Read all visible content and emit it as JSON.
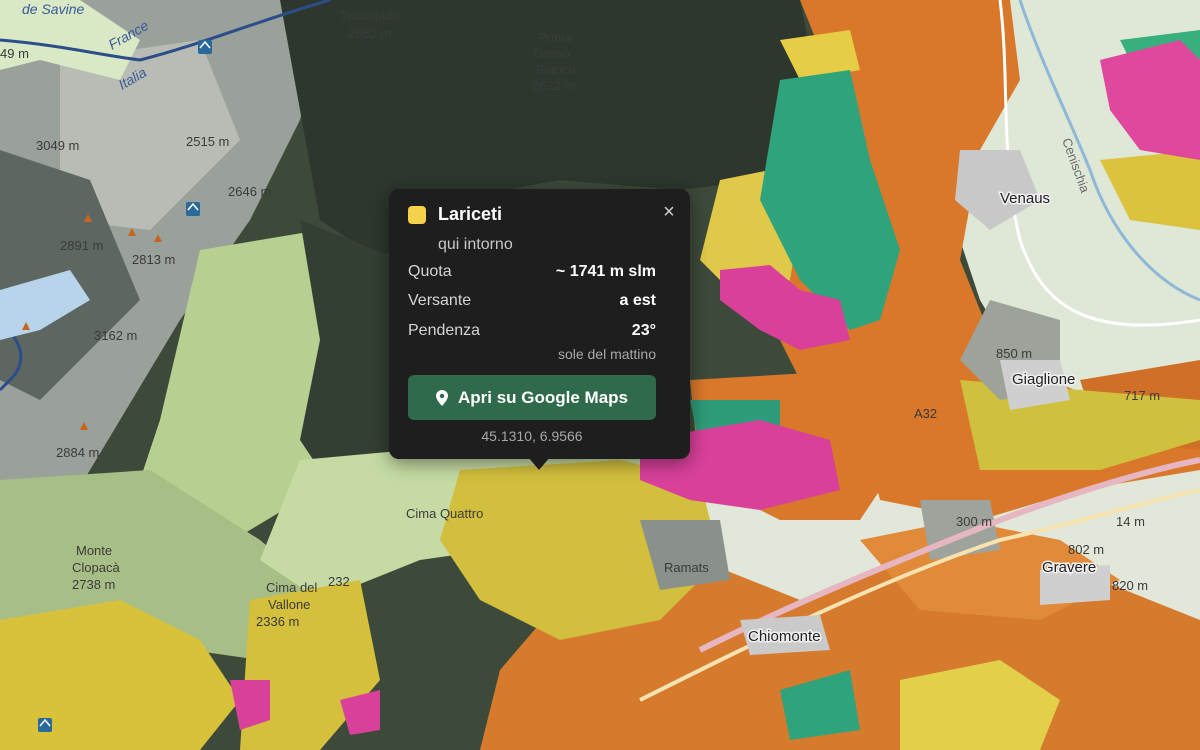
{
  "popup": {
    "title": "Lariceti",
    "swatch_color": "#f3d34a",
    "subtitle": "qui intorno",
    "close_symbol": "×",
    "rows": [
      {
        "label": "Quota",
        "value": "~ 1741 m slm"
      },
      {
        "label": "Versante",
        "value": "a est"
      },
      {
        "label": "Pendenza",
        "value": "23°"
      }
    ],
    "note": "sole del mattino",
    "button_label": "Apri su Google Maps",
    "button_icon": "map-pin-icon",
    "coords": "45.1310, 6.9566"
  },
  "map": {
    "labels": {
      "de_savine": "de Savine",
      "tricuspide": "Tricuspide",
      "tricuspide_elev": "2882 m",
      "punta": "Punta",
      "tiasso": "Tiasso",
      "bianco": "Bianco",
      "bianco_elev": "2622 m",
      "m2515": "2515 m",
      "m3049": "3049 m",
      "m2646": "2646 m",
      "m2891": "2891 m",
      "m2813": "2813 m",
      "m3162": "3162 m",
      "m2884": "2884 m",
      "m49": "49 m",
      "france": "France",
      "italia": "Italia",
      "venaus": "Venaus",
      "giaglione": "Giaglione",
      "m850": "850 m",
      "m717": "717 m",
      "gravere": "Gravere",
      "m802": "802 m",
      "m300": "300 m",
      "chiomonte": "Chiomonte",
      "monte_clopaca": "Monte",
      "monte_clopaca2": "Clopacà",
      "m2738": "2738 m",
      "cima_del": "Cima del",
      "valloncelli": "Vallone",
      "m2336": "2336 m",
      "cima_quattro": "Cima Quattro",
      "ramats": "Ramats",
      "a32": "A32",
      "m232": "232",
      "cenischia": "Cenischia",
      "m14": "14 m",
      "m820": "820 m"
    }
  },
  "colors": {
    "orange": "#d9782a",
    "yellow": "#d8c23c",
    "teal": "#2ea37c",
    "magenta": "#d8409a",
    "dark_forest": "#2b352b",
    "light_green": "#c9dfa6",
    "grey": "#8f968c",
    "button_green": "#2f6b4a"
  }
}
